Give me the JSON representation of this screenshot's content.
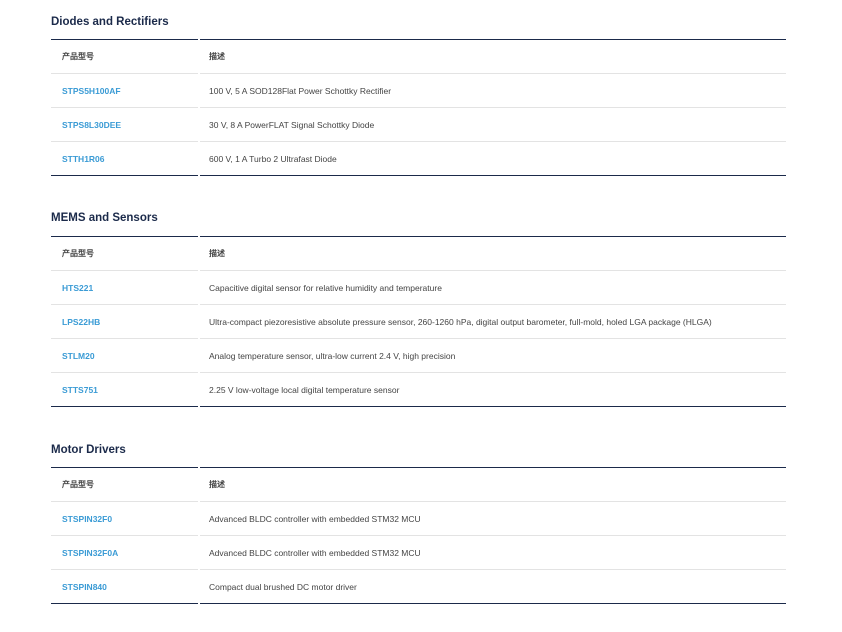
{
  "sections": [
    {
      "title": "Diodes and Rectifiers",
      "headers": {
        "part": "产品型号",
        "desc": "描述"
      },
      "rows": [
        {
          "part": "STPS5H100AF",
          "desc": "100 V, 5 A SOD128Flat Power Schottky Rectifier"
        },
        {
          "part": "STPS8L30DEE",
          "desc": "30 V, 8 A PowerFLAT Signal Schottky Diode"
        },
        {
          "part": "STTH1R06",
          "desc": "600 V, 1 A Turbo 2 Ultrafast Diode"
        }
      ]
    },
    {
      "title": "MEMS and Sensors",
      "headers": {
        "part": "产品型号",
        "desc": "描述"
      },
      "rows": [
        {
          "part": "HTS221",
          "desc": "Capacitive digital sensor for relative humidity and temperature"
        },
        {
          "part": "LPS22HB",
          "desc": "Ultra-compact piezoresistive absolute pressure sensor, 260-1260 hPa, digital output barometer, full-mold, holed LGA package (HLGA)"
        },
        {
          "part": "STLM20",
          "desc": "Analog temperature sensor, ultra-low current 2.4 V, high precision"
        },
        {
          "part": "STTS751",
          "desc": "2.25 V low-voltage local digital temperature sensor"
        }
      ]
    },
    {
      "title": "Motor Drivers",
      "headers": {
        "part": "产品型号",
        "desc": "描述"
      },
      "rows": [
        {
          "part": "STSPIN32F0",
          "desc": "Advanced BLDC controller with embedded STM32 MCU"
        },
        {
          "part": "STSPIN32F0A",
          "desc": "Advanced BLDC controller with embedded STM32 MCU"
        },
        {
          "part": "STSPIN840",
          "desc": "Compact dual brushed DC motor driver"
        }
      ]
    }
  ]
}
